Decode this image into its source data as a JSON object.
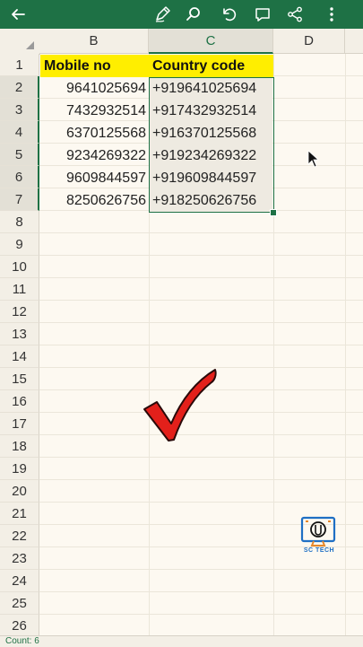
{
  "toolbar": {
    "icons": [
      "back-arrow-icon",
      "pen-icon",
      "search-icon",
      "undo-icon",
      "comment-icon",
      "share-icon",
      "more-icon"
    ],
    "background": "#1e7145"
  },
  "columns": [
    "B",
    "C",
    "D"
  ],
  "rows": [
    "1",
    "2",
    "3",
    "4",
    "5",
    "6",
    "7",
    "8",
    "9",
    "10",
    "11",
    "12",
    "13",
    "14",
    "15",
    "16",
    "17",
    "18",
    "19",
    "20",
    "21",
    "22",
    "23",
    "24",
    "25",
    "26"
  ],
  "table": {
    "headers": [
      "Mobile no",
      "Country code"
    ],
    "data": [
      [
        "9641025694",
        "+919641025694"
      ],
      [
        "7432932514",
        "+917432932514"
      ],
      [
        "6370125568",
        "+916370125568"
      ],
      [
        "9234269322",
        "+919234269322"
      ],
      [
        "9609844597",
        "+919609844597"
      ],
      [
        "8250626756",
        "+918250626756"
      ]
    ]
  },
  "watermark": {
    "text": "SC TECH"
  },
  "status": {
    "text": "Count: 6"
  },
  "colors": {
    "header_fill": "#ffee00",
    "accent": "#1e7145",
    "check": "#e3201b"
  }
}
